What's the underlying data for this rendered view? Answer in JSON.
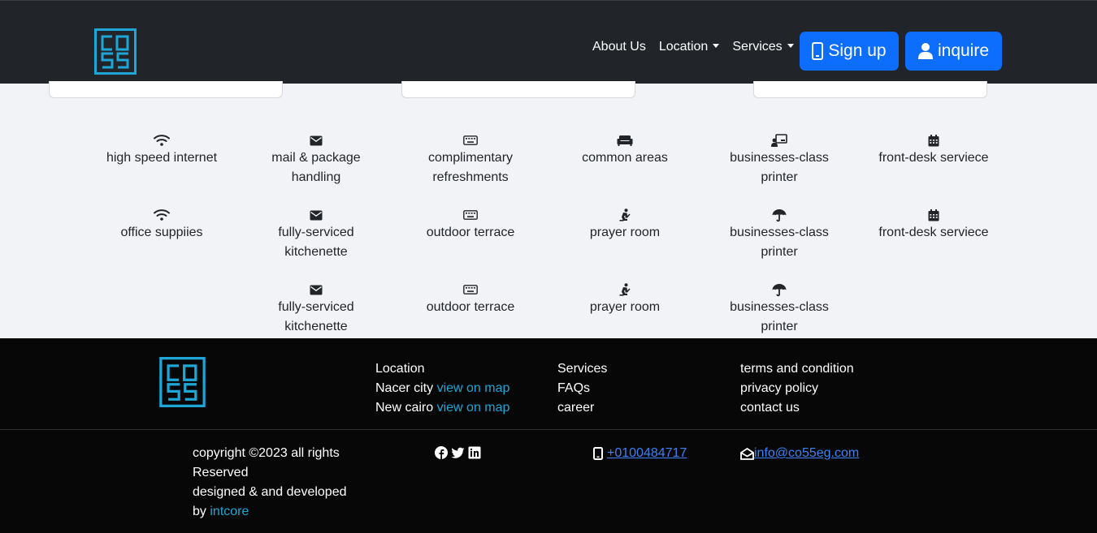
{
  "nav": {
    "links": [
      "About Us",
      "Location",
      "Services"
    ],
    "signup_label": "Sign up",
    "inquire_label": "inquire"
  },
  "amenities": {
    "rows": [
      [
        {
          "icon": "wifi-icon",
          "label": "high speed internet"
        },
        {
          "icon": "envelope-icon",
          "label": "mail & package handling"
        },
        {
          "icon": "keyboard-icon",
          "label": "complimentary refreshments"
        },
        {
          "icon": "couch-icon",
          "label": "common areas"
        },
        {
          "icon": "chalkboard-user-icon",
          "label": "businesses-class printer"
        },
        {
          "icon": "calendar-icon",
          "label": "front-desk serviece"
        }
      ],
      [
        {
          "icon": "wifi-icon",
          "label": "office suppiies"
        },
        {
          "icon": "envelope-icon",
          "label": "fully-serviced kitchenette"
        },
        {
          "icon": "keyboard-icon",
          "label": "outdoor terrace"
        },
        {
          "icon": "praying-icon",
          "label": "prayer room"
        },
        {
          "icon": "umbrella-icon",
          "label": "businesses-class printer"
        },
        {
          "icon": "calendar-icon",
          "label": "front-desk serviece"
        }
      ],
      [
        {
          "icon": "envelope-icon",
          "label": "fully-serviced kitchenette"
        },
        {
          "icon": "keyboard-icon",
          "label": "outdoor terrace"
        },
        {
          "icon": "praying-icon",
          "label": "prayer room"
        },
        {
          "icon": "umbrella-icon",
          "label": "businesses-class printer"
        }
      ]
    ]
  },
  "footer": {
    "location": {
      "title": "Location",
      "items": [
        {
          "name": "Nacer city",
          "link": "view on map"
        },
        {
          "name": "New cairo",
          "link": "view on map"
        }
      ]
    },
    "services": [
      "Services",
      "FAQs",
      "career"
    ],
    "legal": [
      "terms and condition",
      "privacy policy",
      "contact us"
    ],
    "copyright": "copyright ©2023 all rights Reserved",
    "designed": "designed & and developed",
    "by": "by",
    "company": "intcore",
    "phone": "+0100484717",
    "email": "info@co55eg.com"
  },
  "colors": {
    "brand": "#1ea6d6",
    "primary": "#0d6efd",
    "nav_bg": "#212529",
    "footer_bg": "#070707"
  }
}
